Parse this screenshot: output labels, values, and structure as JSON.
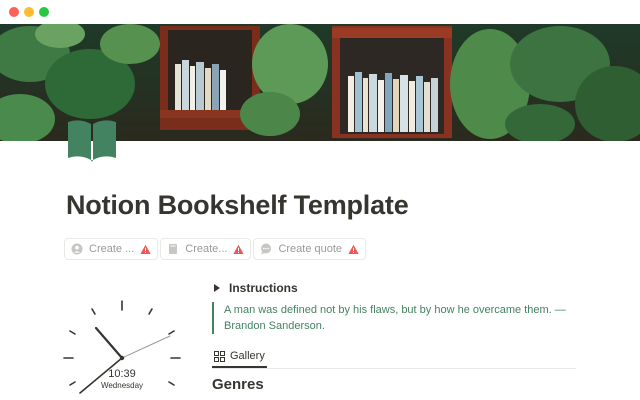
{
  "page": {
    "title": "Notion Bookshelf Template",
    "icon": "open-book-icon",
    "cover": "bookshelf-plants-photo"
  },
  "colors": {
    "accent_green": "#448361",
    "text": "#37352f",
    "muted": "#9b9a97",
    "warning": "#eb5757"
  },
  "buttons": [
    {
      "label": "Create ...",
      "icon": "user-circle-icon",
      "status_icon": "warning-icon"
    },
    {
      "label": "Create...",
      "icon": "book-icon",
      "status_icon": "warning-icon"
    },
    {
      "label": "Create quote",
      "icon": "chat-bubble-icon",
      "status_icon": "warning-icon"
    }
  ],
  "toggle": {
    "label": "Instructions"
  },
  "quote": {
    "text": "A man was defined not by his flaws, but by how he overcame them. — Brandon Sanderson."
  },
  "view_tabs": [
    {
      "label": "Gallery",
      "icon": "gallery-grid-icon",
      "selected": true
    }
  ],
  "section": {
    "heading": "Genres"
  },
  "clock": {
    "time": "10:39",
    "day": "Wednesday"
  }
}
